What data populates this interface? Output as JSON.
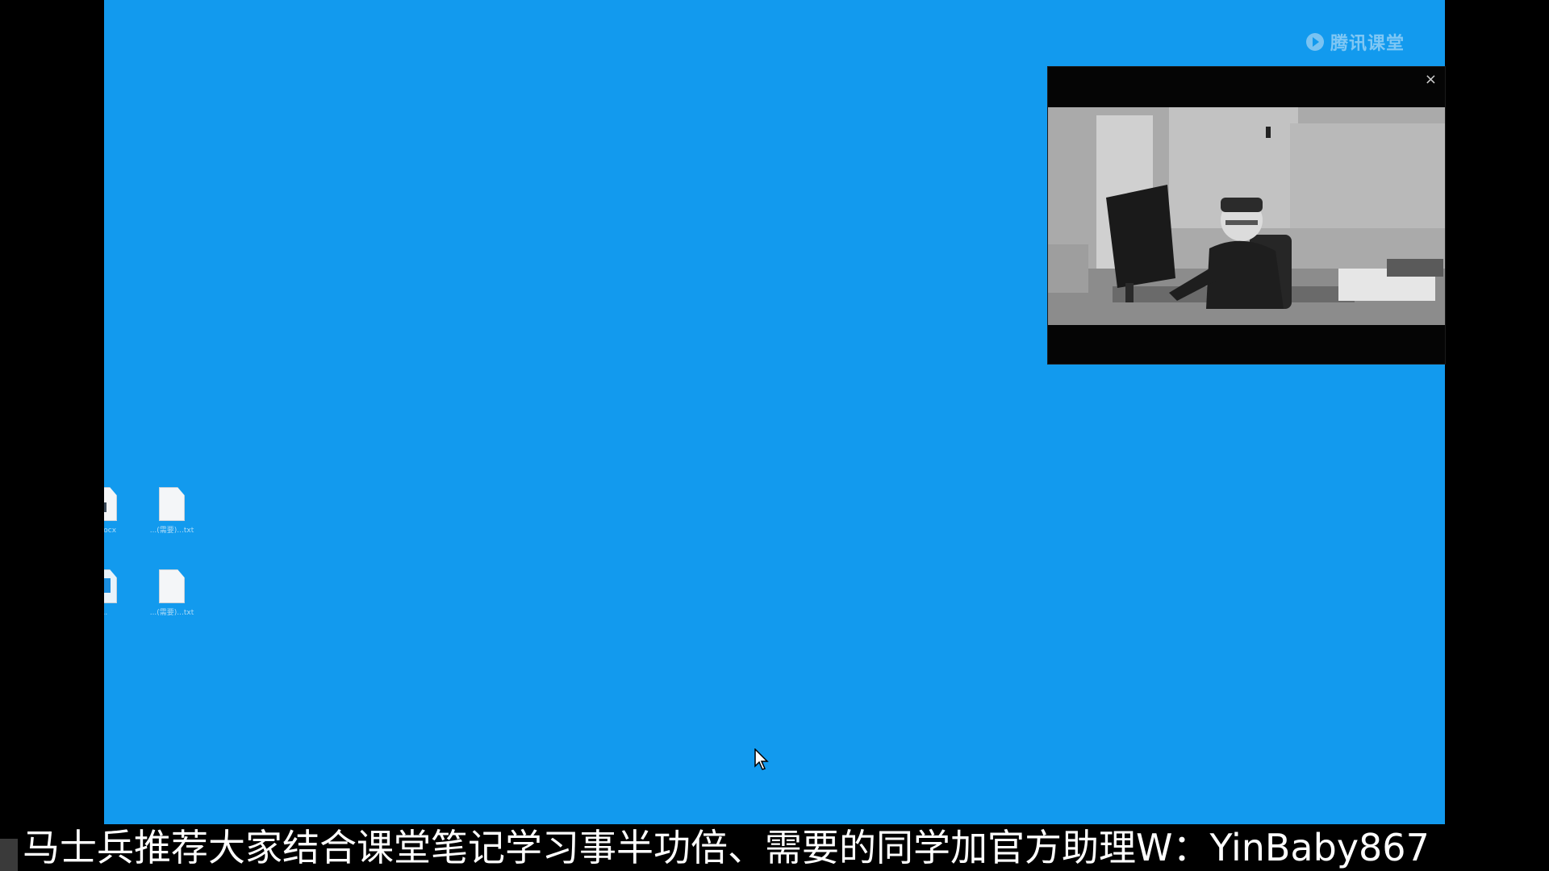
{
  "desktop": {
    "background_color": "#129aee",
    "watermark": {
      "icon": "play-circle-icon",
      "text": "腾讯课堂"
    },
    "icons": [
      {
        "label": "...docx",
        "icon": "word-document-icon"
      },
      {
        "label": "...(需要)...txt",
        "icon": "text-file-icon"
      },
      {
        "label": "...",
        "icon": "image-file-icon"
      },
      {
        "label": "...(需要)...txt",
        "icon": "text-file-icon"
      }
    ]
  },
  "video_window": {
    "close_label": "×"
  },
  "subtitle": {
    "text": "马士兵推荐大家结合课堂笔记学习事半功倍、需要的同学加官方助理W：YinBaby867"
  }
}
